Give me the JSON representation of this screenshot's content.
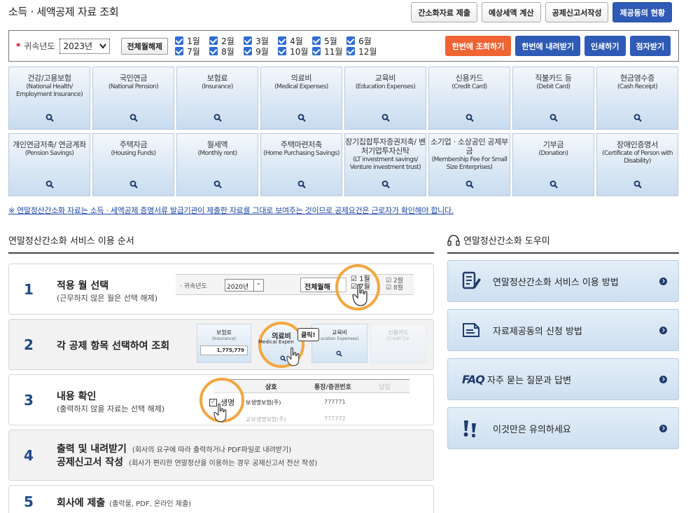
{
  "header": {
    "title": "소득 · 세액공제 자료 조회",
    "buttons": [
      "간소화자료 제출",
      "예상세액 계산",
      "공제신고서작성",
      "제공동의 현황"
    ]
  },
  "filter": {
    "required_mark": "*",
    "year_label": "귀속년도",
    "year_value": "2023년",
    "deselect_all": "전체월해제",
    "months": [
      "1월",
      "2월",
      "3월",
      "4월",
      "5월",
      "6월",
      "7월",
      "8월",
      "9월",
      "10월",
      "11월",
      "12월"
    ],
    "actions": {
      "query_all": "한번에 조회하기",
      "download_all": "한번에 내려받기",
      "print": "인쇄하기",
      "braille": "점자받기"
    }
  },
  "categories": [
    {
      "title": "건강/고용보험",
      "sub": "(National Health/ Employment Insurance)"
    },
    {
      "title": "국민연금",
      "sub": "(National Pension)"
    },
    {
      "title": "보험료",
      "sub": "(Insurance)"
    },
    {
      "title": "의료비",
      "sub": "(Medical Expenses)"
    },
    {
      "title": "교육비",
      "sub": "(Education Expenses)"
    },
    {
      "title": "신용카드",
      "sub": "(Credit Card)"
    },
    {
      "title": "직불카드 등",
      "sub": "(Debit Card)"
    },
    {
      "title": "현금영수증",
      "sub": "(Cash Receipt)"
    },
    {
      "title": "개인연금저축/ 연금계좌",
      "sub": "(Pension Savings)"
    },
    {
      "title": "주택자금",
      "sub": "(Housing Funds)"
    },
    {
      "title": "월세액",
      "sub": "(Monthly rent)"
    },
    {
      "title": "주택마련저축",
      "sub": "(Home Purchasing Savings)"
    },
    {
      "title": "장기집합투자증권저축/ 벤처기업투자신탁",
      "sub": "(LT investment savings/ Venture investment trust)"
    },
    {
      "title": "소기업 · 소상공인 공제부금",
      "sub": "(Membership Fee For Small Size Enterprises)"
    },
    {
      "title": "기부금",
      "sub": "(Donation)"
    },
    {
      "title": "장애인증명서",
      "sub": "(Certificate of Person with Disability)"
    }
  ],
  "notice": "※ 연말정산간소화 자료는 소득 · 세액공제 증명서류 발급기관이 제출한 자료를 그대로 보여주는 것이므로 공제요건은 근로자가 확인해야 합니다.",
  "process": {
    "title": "연말정산간소화 서비스 이용 순서",
    "steps": [
      {
        "num": "1",
        "main": "적용 월 선택",
        "sub": "(근무하지 않은 월은 선택 해제)"
      },
      {
        "num": "2",
        "main": "각 공제 항목 선택하여 조회",
        "sub": ""
      },
      {
        "num": "3",
        "main": "내용 확인",
        "sub": "(출력하지 않을 자료는 선택 해제)"
      },
      {
        "num": "4",
        "main": "출력 및 내려받기",
        "note": "(회사의 요구에 따라 출력하거나 PDF파일로 내려받기)",
        "main2": "공제신고서 작성",
        "note2": "(회사가 편리한 연말정산을 이용하는 경우 공제신고서 전산 작성)"
      },
      {
        "num": "5",
        "main": "회사에 제출",
        "note": "(출력물, PDF, 온라인 제출)"
      }
    ],
    "ill1": {
      "year_label": "귀속년도",
      "year_value": "2020년",
      "deselect": "전체월해",
      "m1": "1월",
      "m7": "7월",
      "m2": "2월",
      "m8": "8월"
    },
    "ill2": {
      "c1_title": "보험료",
      "c1_sub": "(Insurance)",
      "c1_value": "1,775,779",
      "c2_title": "의료비",
      "c2_sub": "Medical Expen",
      "c3_title": "교육비",
      "c3_sub": "ucation Expenses)",
      "c4_title": "신용카드",
      "c4_sub": "(Credit Car",
      "click": "클릭!"
    },
    "ill3": {
      "col_name": "상호",
      "col_reg": "통장/증권번호",
      "col_extra": "납입",
      "row1_name": "생명",
      "row1_full": "보생명보험(주)",
      "row1_num": "777771",
      "row2_full": "교보생명보험(주)",
      "row2_num": "777772"
    }
  },
  "helper": {
    "title": "연말정산간소화 도우미",
    "items": [
      {
        "icon": "document-pen-icon",
        "label": "연말정산간소화 서비스 이용 방법"
      },
      {
        "icon": "document-icon",
        "label": "자료제공동의 신청 방법"
      },
      {
        "icon": "faq-icon",
        "prefix": "FAQ",
        "label": "자주 묻는 질문과 답변"
      },
      {
        "icon": "exclamation-icon",
        "label": "이것만은 유의하세요"
      }
    ]
  }
}
